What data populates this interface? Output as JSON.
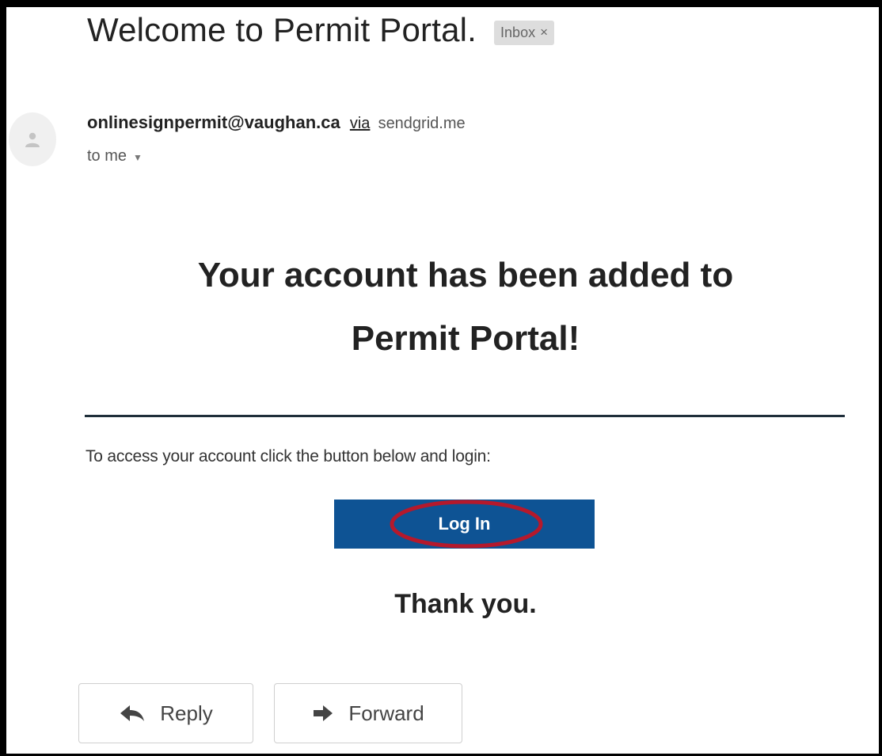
{
  "email": {
    "subject": "Welcome to Permit Portal.",
    "label": "Inbox",
    "label_close": "×",
    "sender": "onlinesignpermit@vaughan.ca",
    "via": "via",
    "via_domain": "sendgrid.me",
    "recipient": "to me"
  },
  "body": {
    "headline_line1": "Your account has been added to",
    "headline_line2": "Permit Portal!",
    "instructions": "To access your account click the button below and login:",
    "login_label": "Log In",
    "thanks": "Thank you."
  },
  "actions": {
    "reply": "Reply",
    "forward": "Forward"
  },
  "colors": {
    "login_button": "#0e5394",
    "highlight_ring": "#b5192c",
    "divider": "#1f2e3a"
  },
  "icons": {
    "avatar": "person-icon",
    "recipient_menu": "caret-down-icon",
    "reply": "reply-arrow-icon",
    "forward": "forward-arrow-icon"
  }
}
